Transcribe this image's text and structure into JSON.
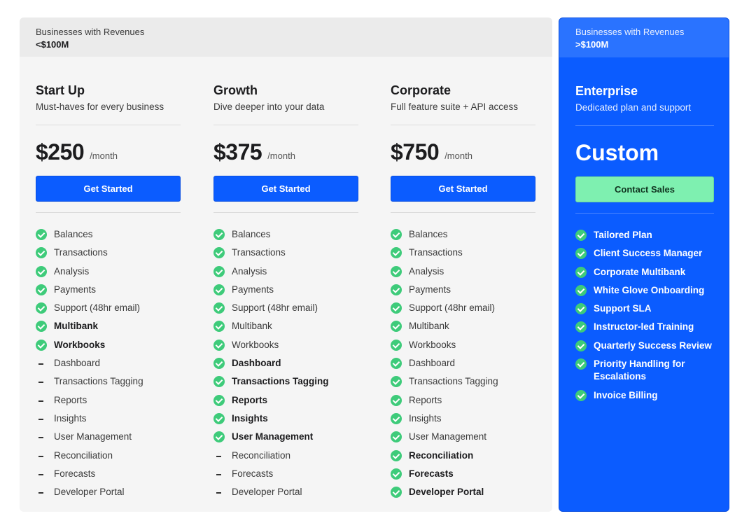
{
  "segments": {
    "small": {
      "line1": "Businesses with Revenues",
      "line2": "<$100M"
    },
    "large": {
      "line1": "Businesses with Revenues",
      "line2": ">$100M"
    }
  },
  "plans": [
    {
      "name": "Start Up",
      "desc": "Must-haves for every business",
      "price": "$250",
      "per": "/month",
      "cta": "Get Started",
      "features": [
        {
          "label": "Balances",
          "icon": "check-icon",
          "bold": false
        },
        {
          "label": "Transactions",
          "icon": "check-icon",
          "bold": false
        },
        {
          "label": "Analysis",
          "icon": "check-icon",
          "bold": false
        },
        {
          "label": "Payments",
          "icon": "check-icon",
          "bold": false
        },
        {
          "label": "Support (48hr email)",
          "icon": "check-icon",
          "bold": false
        },
        {
          "label": "Multibank",
          "icon": "check-icon",
          "bold": true
        },
        {
          "label": "Workbooks",
          "icon": "check-icon",
          "bold": true
        },
        {
          "label": "Dashboard",
          "icon": "dash-icon",
          "bold": false
        },
        {
          "label": "Transactions Tagging",
          "icon": "dash-icon",
          "bold": false
        },
        {
          "label": "Reports",
          "icon": "dash-icon",
          "bold": false
        },
        {
          "label": "Insights",
          "icon": "dash-icon",
          "bold": false
        },
        {
          "label": "User Management",
          "icon": "dash-icon",
          "bold": false
        },
        {
          "label": "Reconciliation",
          "icon": "dash-icon",
          "bold": false
        },
        {
          "label": "Forecasts",
          "icon": "dash-icon",
          "bold": false
        },
        {
          "label": "Developer Portal",
          "icon": "dash-icon",
          "bold": false
        }
      ]
    },
    {
      "name": "Growth",
      "desc": "Dive deeper into your data",
      "price": "$375",
      "per": "/month",
      "cta": "Get Started",
      "features": [
        {
          "label": "Balances",
          "icon": "check-icon",
          "bold": false
        },
        {
          "label": "Transactions",
          "icon": "check-icon",
          "bold": false
        },
        {
          "label": "Analysis",
          "icon": "check-icon",
          "bold": false
        },
        {
          "label": "Payments",
          "icon": "check-icon",
          "bold": false
        },
        {
          "label": "Support (48hr email)",
          "icon": "check-icon",
          "bold": false
        },
        {
          "label": "Multibank",
          "icon": "check-icon",
          "bold": false
        },
        {
          "label": "Workbooks",
          "icon": "check-icon",
          "bold": false
        },
        {
          "label": "Dashboard",
          "icon": "check-icon",
          "bold": true
        },
        {
          "label": "Transactions Tagging",
          "icon": "check-icon",
          "bold": true
        },
        {
          "label": "Reports",
          "icon": "check-icon",
          "bold": true
        },
        {
          "label": "Insights",
          "icon": "check-icon",
          "bold": true
        },
        {
          "label": "User Management",
          "icon": "check-icon",
          "bold": true
        },
        {
          "label": "Reconciliation",
          "icon": "dash-icon",
          "bold": false
        },
        {
          "label": "Forecasts",
          "icon": "dash-icon",
          "bold": false
        },
        {
          "label": "Developer Portal",
          "icon": "dash-icon",
          "bold": false
        }
      ]
    },
    {
      "name": "Corporate",
      "desc": "Full feature suite + API access",
      "price": "$750",
      "per": "/month",
      "cta": "Get Started",
      "features": [
        {
          "label": "Balances",
          "icon": "check-icon",
          "bold": false
        },
        {
          "label": "Transactions",
          "icon": "check-icon",
          "bold": false
        },
        {
          "label": "Analysis",
          "icon": "check-icon",
          "bold": false
        },
        {
          "label": "Payments",
          "icon": "check-icon",
          "bold": false
        },
        {
          "label": "Support (48hr email)",
          "icon": "check-icon",
          "bold": false
        },
        {
          "label": "Multibank",
          "icon": "check-icon",
          "bold": false
        },
        {
          "label": "Workbooks",
          "icon": "check-icon",
          "bold": false
        },
        {
          "label": "Dashboard",
          "icon": "check-icon",
          "bold": false
        },
        {
          "label": "Transactions Tagging",
          "icon": "check-icon",
          "bold": false
        },
        {
          "label": "Reports",
          "icon": "check-icon",
          "bold": false
        },
        {
          "label": "Insights",
          "icon": "check-icon",
          "bold": false
        },
        {
          "label": "User Management",
          "icon": "check-icon",
          "bold": false
        },
        {
          "label": "Reconciliation",
          "icon": "check-icon",
          "bold": true
        },
        {
          "label": "Forecasts",
          "icon": "check-icon",
          "bold": true
        },
        {
          "label": "Developer Portal",
          "icon": "check-icon",
          "bold": true
        }
      ]
    }
  ],
  "enterprise": {
    "name": "Enterprise",
    "desc": "Dedicated plan and support",
    "price": "Custom",
    "cta": "Contact Sales",
    "features": [
      "Tailored Plan",
      "Client Success Manager",
      "Corporate Multibank",
      "White Glove Onboarding",
      "Support SLA",
      "Instructor-led Training",
      "Quarterly Success Review",
      "Priority Handling for Escalations",
      "Invoice Billing"
    ]
  },
  "colors": {
    "accent": "#0b5cff",
    "check": "#3ecb7a",
    "contact_button": "#7ef0b0",
    "panel_bg": "#f5f5f5"
  }
}
